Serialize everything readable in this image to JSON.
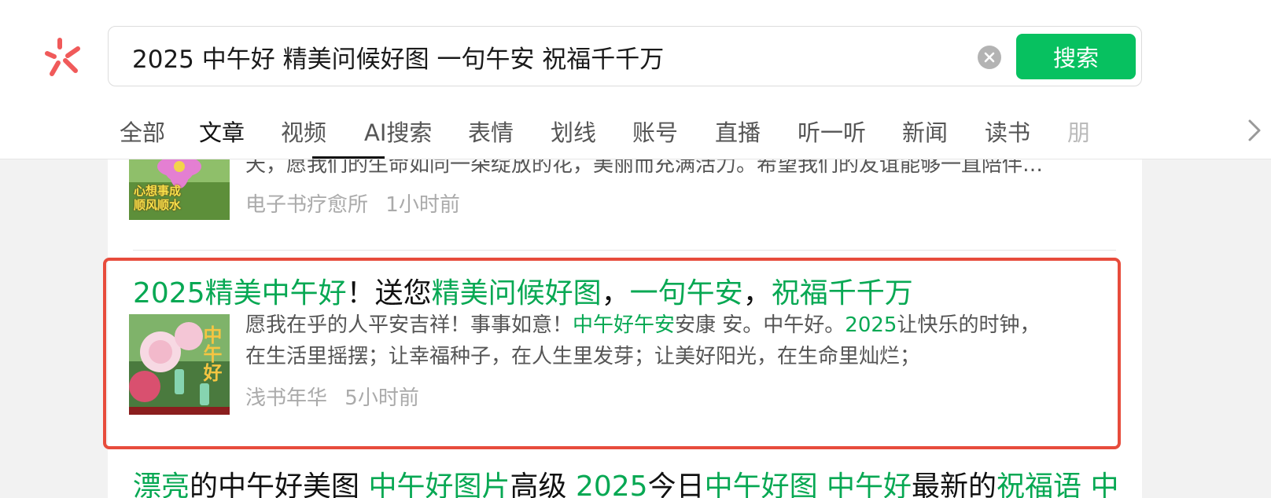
{
  "search": {
    "query": "2025 中午好 精美问候好图 一句午安 祝福千千万",
    "button_label": "搜索",
    "clear_icon": "×"
  },
  "tabs": [
    {
      "label": "全部"
    },
    {
      "label": "文章",
      "active": true
    },
    {
      "label": "视频"
    },
    {
      "label": "AI搜索"
    },
    {
      "label": "表情"
    },
    {
      "label": "划线"
    },
    {
      "label": "账号"
    },
    {
      "label": "直播"
    },
    {
      "label": "听一听"
    },
    {
      "label": "新闻"
    },
    {
      "label": "读书"
    },
    {
      "label": "朋"
    }
  ],
  "results": [
    {
      "snippet": "天，愿我们的生命如同一朵绽放的花，美丽而充满活力。希望我们的友谊能够一直陪伴…",
      "source": "电子书疗愈所",
      "time": "1小时前",
      "thumb_caption": [
        "心想事成",
        "顺风顺水"
      ]
    },
    {
      "title_parts": [
        {
          "text": "2025精美中午好",
          "hl": true
        },
        {
          "text": "！送您",
          "hl": false
        },
        {
          "text": "精美问候好图",
          "hl": true
        },
        {
          "text": "，",
          "hl": false
        },
        {
          "text": "一句午安",
          "hl": true
        },
        {
          "text": "，",
          "hl": false
        },
        {
          "text": "祝福千千万",
          "hl": true
        }
      ],
      "snippet_line1_parts": [
        {
          "text": "愿我在乎的人平安吉祥！事事如意！",
          "hl": false
        },
        {
          "text": "中午好午安",
          "hl": true
        },
        {
          "text": "安康 安。中午好。",
          "hl": false
        },
        {
          "text": "2025",
          "hl": true
        },
        {
          "text": "让快乐的时钟，",
          "hl": false
        }
      ],
      "snippet_line2": "在生活里摇摆；让幸福种子，在人生里发芽；让美好阳光，在生命里灿烂；",
      "source": "浅书年华",
      "time": "5小时前",
      "thumb_caption": "中午好"
    },
    {
      "title_parts": [
        {
          "text": "漂亮",
          "hl": true
        },
        {
          "text": "的中午好美图 ",
          "hl": false
        },
        {
          "text": "中午好图片",
          "hl": true
        },
        {
          "text": "高级 ",
          "hl": false
        },
        {
          "text": "2025",
          "hl": true
        },
        {
          "text": "今日",
          "hl": false
        },
        {
          "text": "中午好图 中午好",
          "hl": true
        },
        {
          "text": "最新的",
          "hl": false
        },
        {
          "text": "祝福语 中",
          "hl": true
        }
      ]
    }
  ],
  "colors": {
    "accent": "#07c160",
    "highlight_text": "#07a853",
    "selection_box": "#e74c3c",
    "logo": "#f05a5a"
  }
}
